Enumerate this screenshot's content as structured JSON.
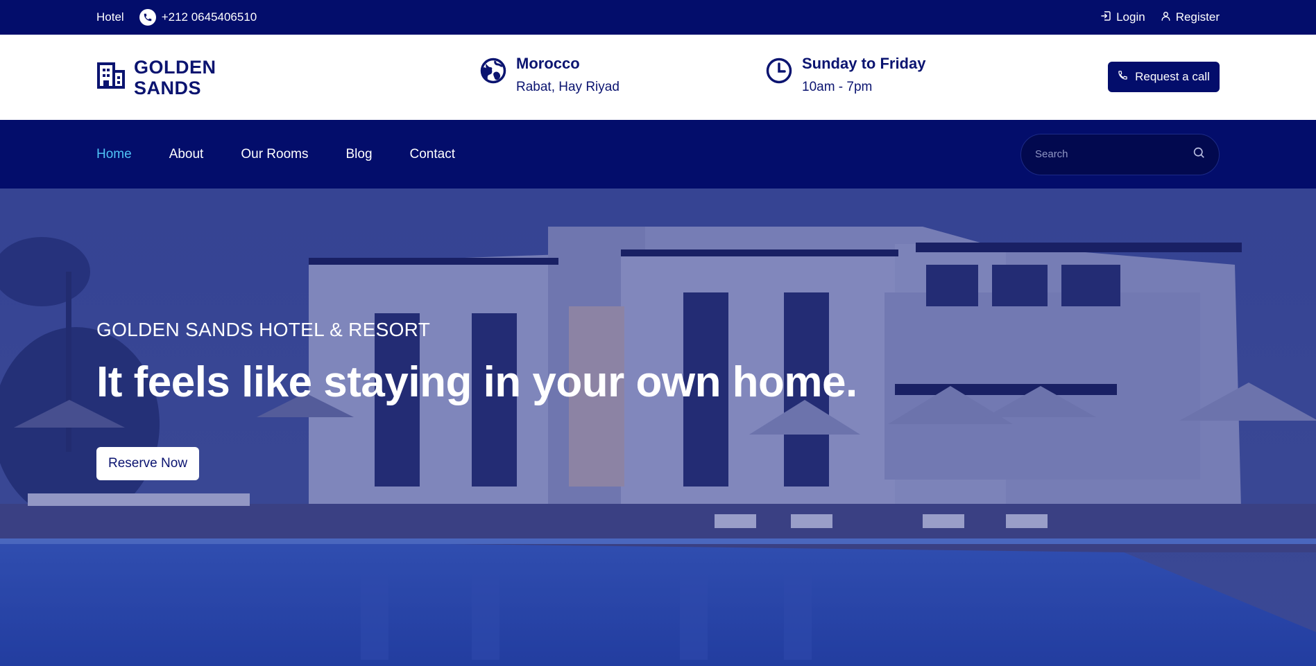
{
  "topbar": {
    "hotel_label": "Hotel",
    "phone": "+212 0645406510",
    "login_label": "Login",
    "register_label": "Register"
  },
  "header": {
    "brand_name": "GOLDEN SANDS",
    "location_title": "Morocco",
    "location_sub": "Rabat, Hay Riyad",
    "hours_title": "Sunday to Friday",
    "hours_sub": "10am - 7pm",
    "call_label": "Request a call"
  },
  "nav": {
    "items": [
      {
        "label": "Home",
        "active": true
      },
      {
        "label": "About",
        "active": false
      },
      {
        "label": "Our Rooms",
        "active": false
      },
      {
        "label": "Blog",
        "active": false
      },
      {
        "label": "Contact",
        "active": false
      }
    ],
    "search_placeholder": "Search"
  },
  "hero": {
    "kicker": "GOLDEN SANDS HOTEL & RESORT",
    "title": "It feels like staying in your own home.",
    "cta_label": "Reserve Now"
  },
  "colors": {
    "primary": "#030d6b",
    "active_link": "#4fc3f7",
    "white": "#ffffff"
  },
  "icons": [
    "phone-icon",
    "login-icon",
    "user-icon",
    "building-icon",
    "globe-icon",
    "clock-icon",
    "search-icon"
  ]
}
